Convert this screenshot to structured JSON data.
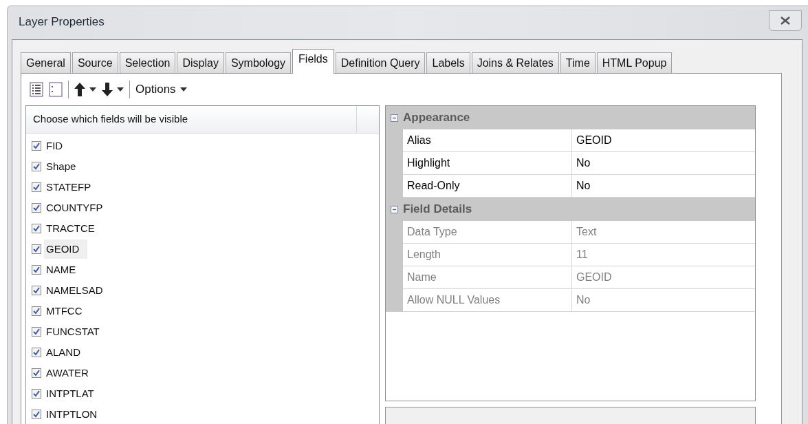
{
  "window": {
    "title": "Layer Properties"
  },
  "tabs": [
    {
      "label": "General",
      "selected": false
    },
    {
      "label": "Source",
      "selected": false
    },
    {
      "label": "Selection",
      "selected": false
    },
    {
      "label": "Display",
      "selected": false
    },
    {
      "label": "Symbology",
      "selected": false
    },
    {
      "label": "Fields",
      "selected": true
    },
    {
      "label": "Definition Query",
      "selected": false
    },
    {
      "label": "Labels",
      "selected": false
    },
    {
      "label": "Joins & Relates",
      "selected": false
    },
    {
      "label": "Time",
      "selected": false
    },
    {
      "label": "HTML Popup",
      "selected": false
    }
  ],
  "toolbar": {
    "options_label": "Options"
  },
  "field_list": {
    "header": "Choose which fields will be visible",
    "items": [
      {
        "label": "FID",
        "checked": true,
        "selected": false
      },
      {
        "label": "Shape",
        "checked": true,
        "selected": false
      },
      {
        "label": "STATEFP",
        "checked": true,
        "selected": false
      },
      {
        "label": "COUNTYFP",
        "checked": true,
        "selected": false
      },
      {
        "label": "TRACTCE",
        "checked": true,
        "selected": false
      },
      {
        "label": "GEOID",
        "checked": true,
        "selected": true
      },
      {
        "label": "NAME",
        "checked": true,
        "selected": false
      },
      {
        "label": "NAMELSAD",
        "checked": true,
        "selected": false
      },
      {
        "label": "MTFCC",
        "checked": true,
        "selected": false
      },
      {
        "label": "FUNCSTAT",
        "checked": true,
        "selected": false
      },
      {
        "label": "ALAND",
        "checked": true,
        "selected": false
      },
      {
        "label": "AWATER",
        "checked": true,
        "selected": false
      },
      {
        "label": "INTPTLAT",
        "checked": true,
        "selected": false
      },
      {
        "label": "INTPTLON",
        "checked": true,
        "selected": false
      }
    ]
  },
  "property_grid": {
    "sections": [
      {
        "title": "Appearance",
        "expanded": true,
        "rows": [
          {
            "name": "Alias",
            "value": "GEOID",
            "disabled": false
          },
          {
            "name": "Highlight",
            "value": "No",
            "disabled": false
          },
          {
            "name": "Read-Only",
            "value": "No",
            "disabled": false
          }
        ]
      },
      {
        "title": "Field Details",
        "expanded": true,
        "rows": [
          {
            "name": "Data Type",
            "value": "Text",
            "disabled": true
          },
          {
            "name": "Length",
            "value": "11",
            "disabled": true
          },
          {
            "name": "Name",
            "value": "GEOID",
            "disabled": true
          },
          {
            "name": "Allow NULL Values",
            "value": "No",
            "disabled": true
          }
        ]
      }
    ]
  }
}
